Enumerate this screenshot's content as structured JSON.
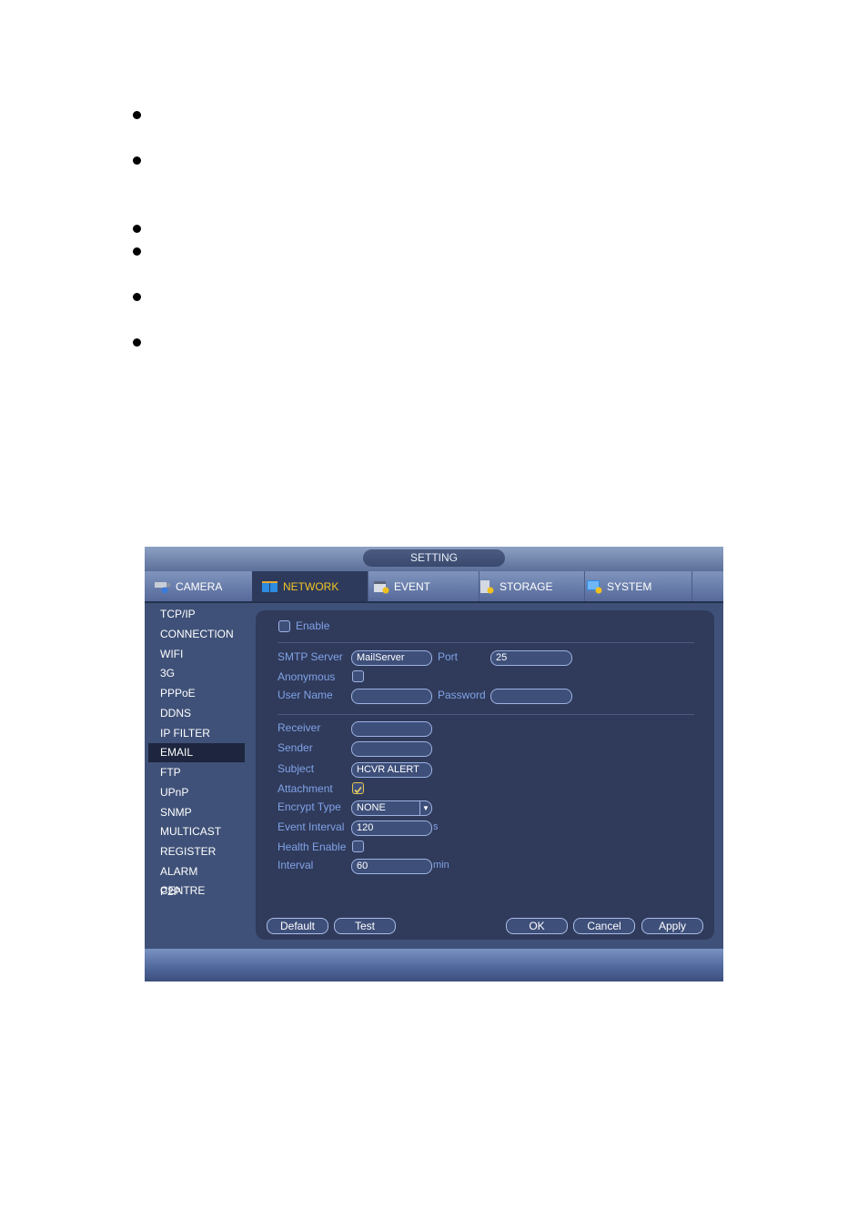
{
  "bullets": 6,
  "window": {
    "title": "SETTING",
    "tabs": [
      {
        "label": "CAMERA",
        "icon": "camera-icon",
        "active": false
      },
      {
        "label": "NETWORK",
        "icon": "network-icon",
        "active": true
      },
      {
        "label": "EVENT",
        "icon": "event-icon",
        "active": false
      },
      {
        "label": "STORAGE",
        "icon": "storage-icon",
        "active": false
      },
      {
        "label": "SYSTEM",
        "icon": "system-icon",
        "active": false
      }
    ],
    "sidebar": {
      "items": [
        "TCP/IP",
        "CONNECTION",
        "WIFI",
        "3G",
        "PPPoE",
        "DDNS",
        "IP FILTER",
        "EMAIL",
        "FTP",
        "UPnP",
        "SNMP",
        "MULTICAST",
        "REGISTER",
        "ALARM CENTRE",
        "P2P"
      ],
      "active_index": 7
    },
    "email": {
      "enable_label": "Enable",
      "enable_checked": false,
      "smtp_server_label": "SMTP Server",
      "smtp_server_value": "MailServer",
      "port_label": "Port",
      "port_value": "25",
      "anonymous_label": "Anonymous",
      "anonymous_checked": false,
      "username_label": "User Name",
      "username_value": "",
      "password_label": "Password",
      "password_value": "",
      "receiver_label": "Receiver",
      "receiver_value": "",
      "sender_label": "Sender",
      "sender_value": "",
      "subject_label": "Subject",
      "subject_value": "HCVR ALERT",
      "attachment_label": "Attachment",
      "attachment_checked": true,
      "encrypt_type_label": "Encrypt Type",
      "encrypt_type_value": "NONE",
      "event_interval_label": "Event Interval",
      "event_interval_value": "120",
      "event_interval_unit": "s",
      "health_enable_label": "Health Enable",
      "health_enable_checked": false,
      "interval_label": "Interval",
      "interval_value": "60",
      "interval_unit": "min"
    },
    "buttons": {
      "default": "Default",
      "test": "Test",
      "ok": "OK",
      "cancel": "Cancel",
      "apply": "Apply"
    },
    "colors": {
      "active_tab_text": "#f2c423",
      "label_text": "#7fa3e8",
      "panel_bg": "#303a5a"
    }
  }
}
